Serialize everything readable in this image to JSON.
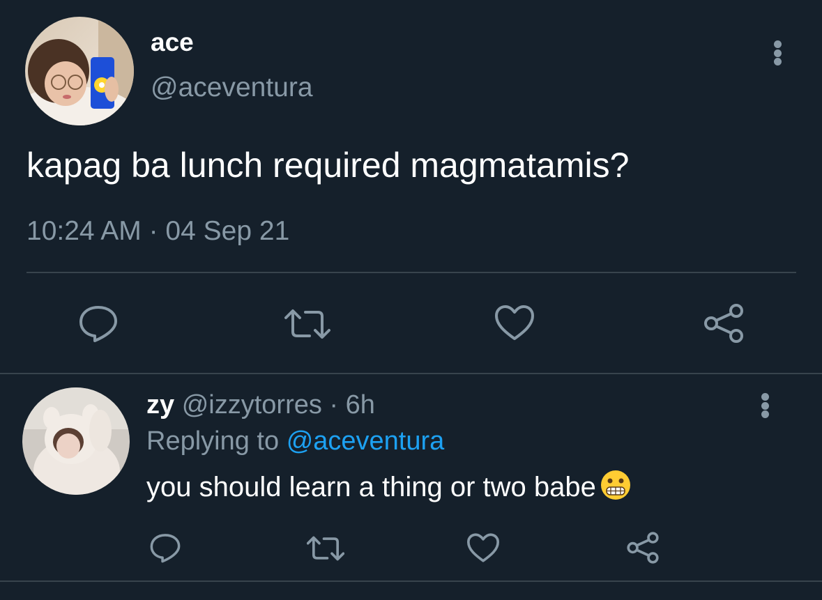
{
  "main_tweet": {
    "display_name": "ace",
    "handle": "@aceventura",
    "text": "kapag ba lunch required magmatamis?",
    "timestamp": "10:24 AM · 04 Sep 21",
    "actions": [
      "reply-icon",
      "retweet-icon",
      "like-icon",
      "share-icon"
    ]
  },
  "reply": {
    "display_name": "zy",
    "handle": "@izzytorres",
    "separator": "·",
    "age": "6h",
    "replying_prefix": "Replying to",
    "replying_to": "@aceventura",
    "text": "you should learn a thing or two babe",
    "emoji": "grimacing-face-emoji",
    "actions": [
      "reply-icon",
      "retweet-icon",
      "like-icon",
      "share-icon"
    ]
  },
  "colors": {
    "background": "#15202b",
    "text_primary": "#ffffff",
    "text_secondary": "#8899a6",
    "link": "#1da1f2",
    "divider": "#38444d"
  }
}
